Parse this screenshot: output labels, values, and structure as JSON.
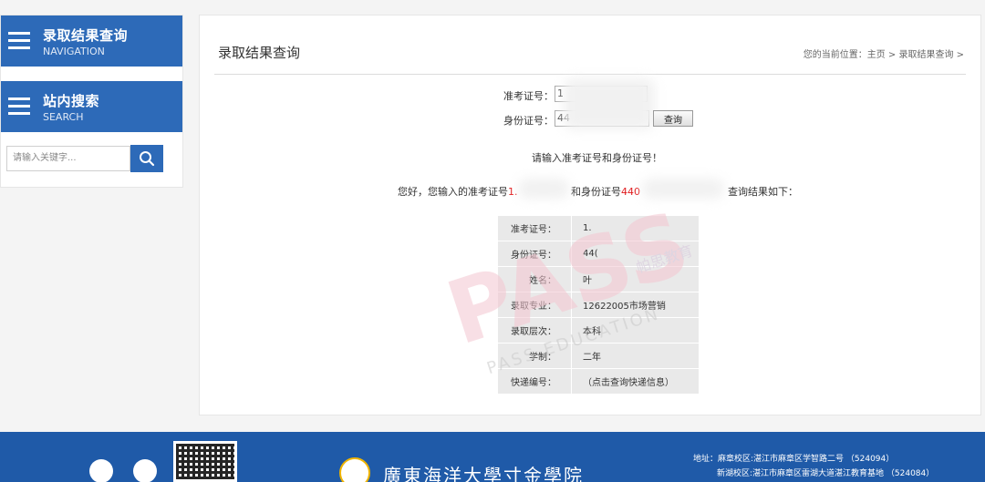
{
  "sidebar": {
    "nav_title": "录取结果查询",
    "nav_sub": "NAVIGATION",
    "search_title": "站内搜索",
    "search_sub": "SEARCH",
    "search_placeholder": "请输入关键字..."
  },
  "main": {
    "title": "录取结果查询",
    "breadcrumb": "您的当前位置：主页 > 录取结果查询 >",
    "exam_label": "准考证号：",
    "exam_value": "1",
    "id_label": "身份证号：",
    "id_value": "44",
    "query_button": "查询",
    "prompt": "请输入准考证号和身份证号！",
    "result_prefix": "您好，您输入的准考证号",
    "result_exam": "1.",
    "result_mid": "和身份证号",
    "result_id": "440",
    "result_suffix": "查询结果如下："
  },
  "result_rows": [
    {
      "key": "准考证号：",
      "value": "1."
    },
    {
      "key": "身份证号：",
      "value": "44("
    },
    {
      "key": "姓名：",
      "value": "叶"
    },
    {
      "key": "录取专业：",
      "value": "12622005市场营销"
    },
    {
      "key": "录取层次：",
      "value": "本科"
    },
    {
      "key": "学制：",
      "value": "二年"
    },
    {
      "key": "快递编号：",
      "value": "（点击查询快递信息）"
    }
  ],
  "watermark": {
    "text": "PASS",
    "sub": "PASS EDUCATION",
    "cn": "帕思教育"
  },
  "footer": {
    "school_name": "廣東海洋大學寸金學院",
    "addr1": "地址：麻章校区:湛江市麻章区学智路二号 （524094）",
    "addr2": "新湖校区:湛江市麻章区雷湖大道湛江教育基地 （524084）"
  },
  "colors": {
    "primary": "#2d6ab8",
    "footer": "#1f5aa8",
    "red": "#e0191b"
  }
}
